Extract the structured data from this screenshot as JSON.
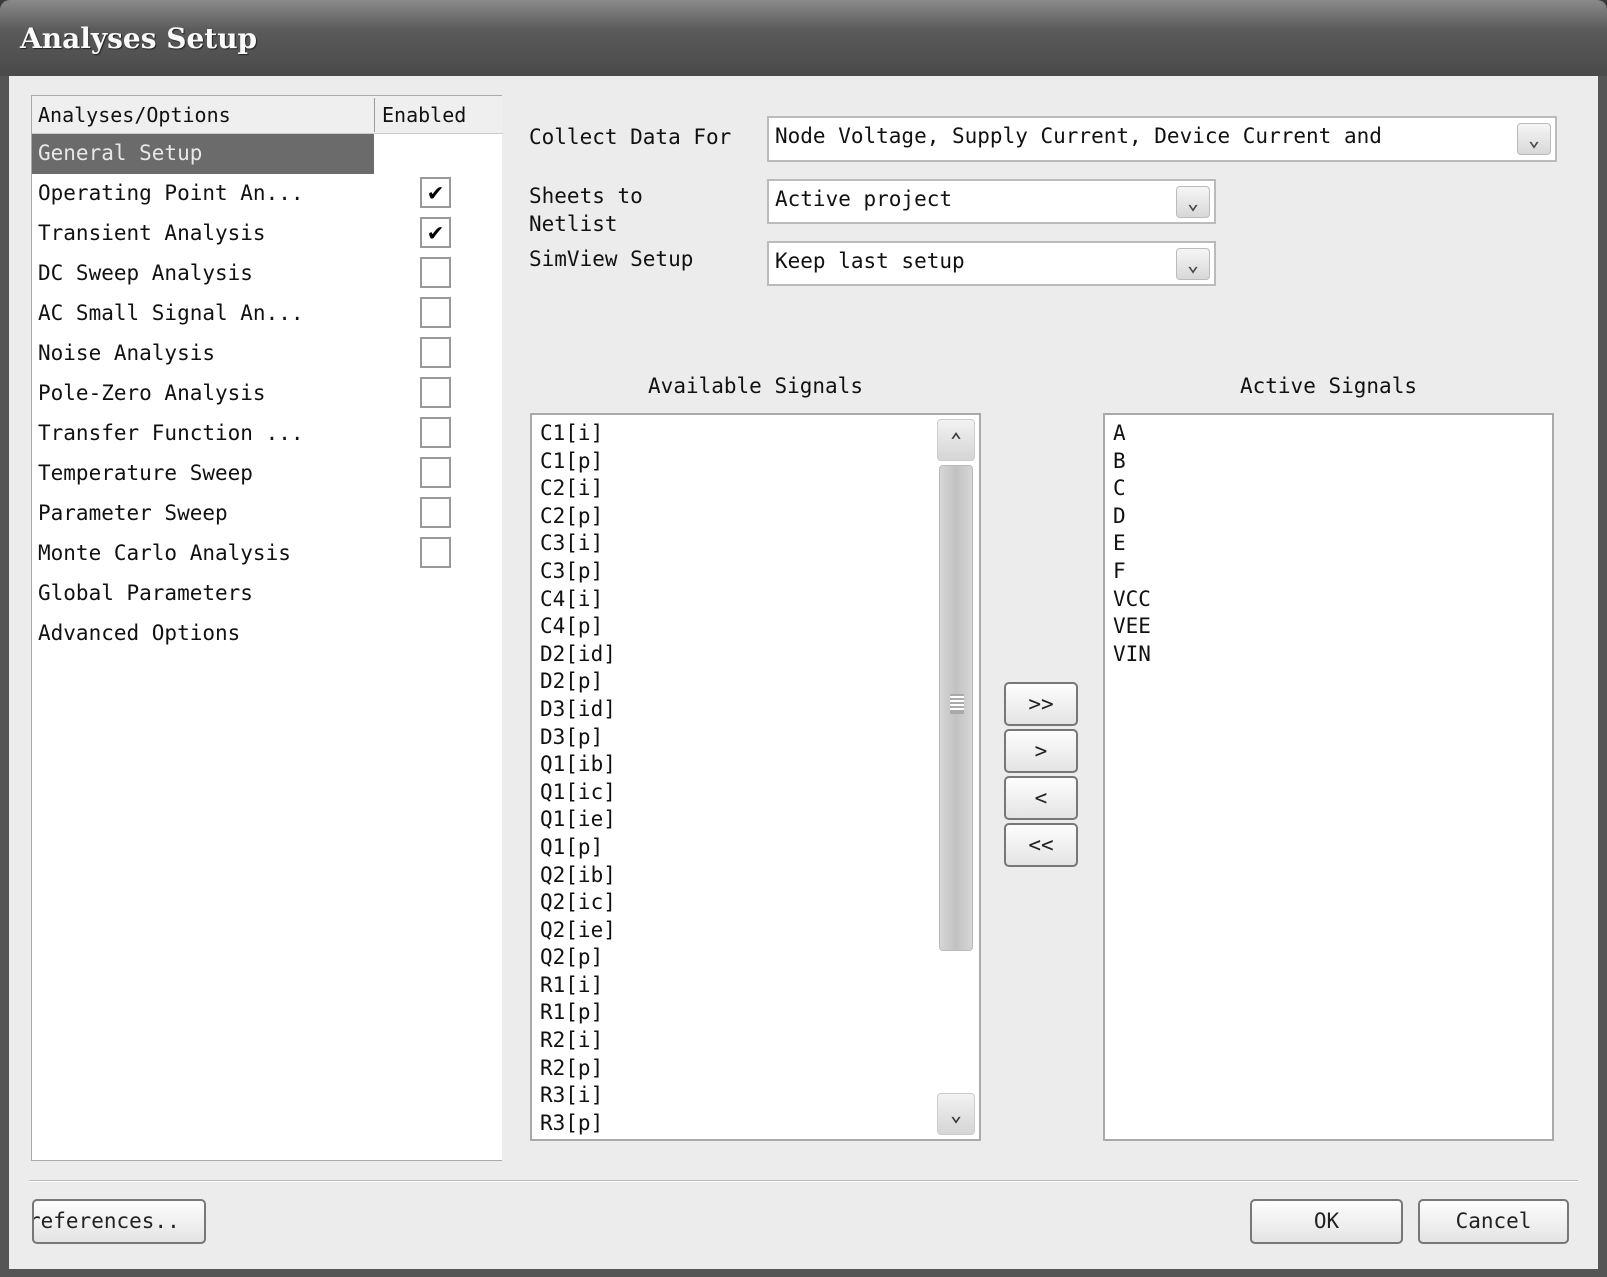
{
  "window": {
    "title": "Analyses Setup"
  },
  "tree": {
    "headers": {
      "name": "Analyses/Options",
      "enabled": "Enabled"
    },
    "items": [
      {
        "label": "General Setup",
        "selected": true
      },
      {
        "label": "Operating Point An...",
        "checked": true
      },
      {
        "label": "Transient Analysis",
        "checked": true
      },
      {
        "label": "DC Sweep Analysis",
        "checked": false
      },
      {
        "label": "AC Small Signal An...",
        "checked": false
      },
      {
        "label": "Noise Analysis",
        "checked": false
      },
      {
        "label": "Pole-Zero Analysis",
        "checked": false
      },
      {
        "label": "Transfer Function ...",
        "checked": false
      },
      {
        "label": "Temperature Sweep",
        "checked": false
      },
      {
        "label": "Parameter Sweep",
        "checked": false
      },
      {
        "label": "Monte Carlo Analysis",
        "checked": false
      },
      {
        "label": "Global Parameters"
      },
      {
        "label": "Advanced Options"
      }
    ]
  },
  "settings": {
    "collect_label": "Collect Data For",
    "collect_value": "Node Voltage, Supply Current, Device Current and",
    "sheets_label_1": "Sheets to",
    "sheets_label_2": "Netlist",
    "sheets_value": "Active project",
    "simview_label": "SimView Setup",
    "simview_value": "Keep last setup"
  },
  "available": {
    "title": "Available Signals",
    "items": [
      "C1[i]",
      "C1[p]",
      "C2[i]",
      "C2[p]",
      "C3[i]",
      "C3[p]",
      "C4[i]",
      "C4[p]",
      "D2[id]",
      "D2[p]",
      "D3[id]",
      "D3[p]",
      "Q1[ib]",
      "Q1[ic]",
      "Q1[ie]",
      "Q1[p]",
      "Q2[ib]",
      "Q2[ic]",
      "Q2[ie]",
      "Q2[p]",
      "R1[i]",
      "R1[p]",
      "R2[i]",
      "R2[p]",
      "R3[i]",
      "R3[p]"
    ]
  },
  "active": {
    "title": "Active Signals",
    "items": [
      "A",
      "B",
      "C",
      "D",
      "E",
      "F",
      "VCC",
      "VEE",
      "VIN"
    ]
  },
  "transfer": {
    "add_all": ">>",
    "add": ">",
    "remove": "<",
    "remove_all": "<<"
  },
  "footer": {
    "preferences": "references..",
    "ok": "OK",
    "cancel": "Cancel"
  }
}
